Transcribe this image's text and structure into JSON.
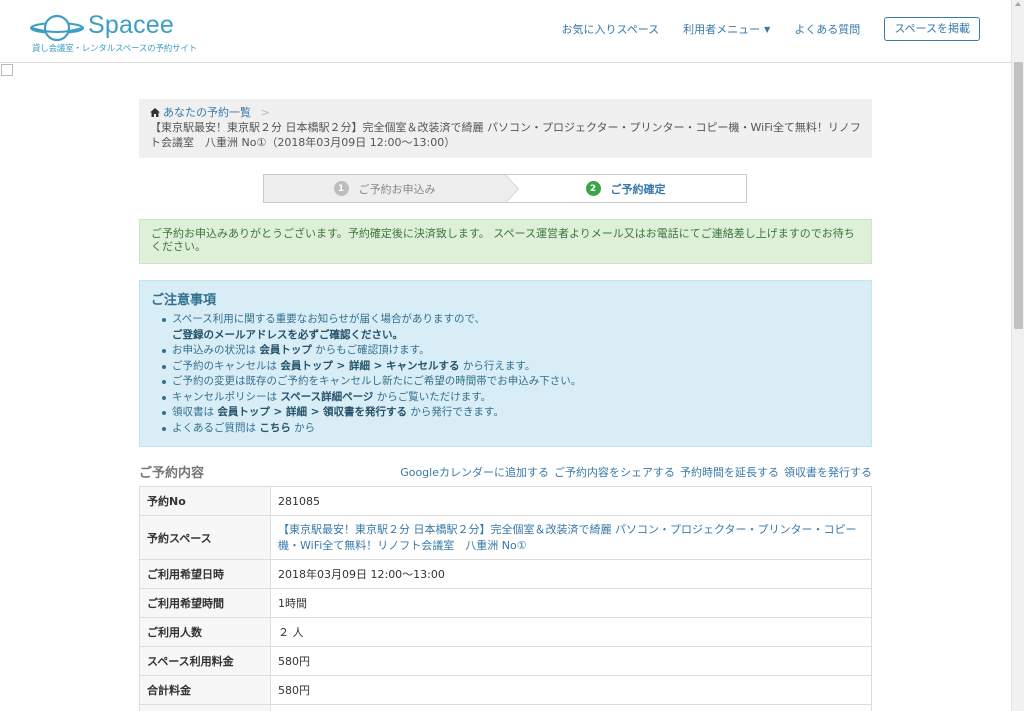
{
  "header": {
    "logo_text": "Spacee",
    "logo_sub": "貸し会議室・レンタルスペースの予約サイト",
    "nav": {
      "favorites": "お気に入りスペース",
      "user_menu": "利用者メニュー",
      "faq": "よくある質問",
      "post_space": "スペースを掲載"
    }
  },
  "breadcrumb": {
    "home": "あなたの予約一覧",
    "separator": ">",
    "current": "【東京駅最安！東京駅２分 日本橋駅２分】完全個室＆改装済で綺麗 パソコン・プロジェクター・プリンター・コピー機・WiFi全て無料！リノフト会議室　八重洲 No①（2018年03月09日 12:00〜13:00）"
  },
  "steps": [
    {
      "num": "1",
      "label": "ご予約お申込み"
    },
    {
      "num": "2",
      "label": "ご予約確定"
    }
  ],
  "alert_success": "ご予約お申込みありがとうございます。予約確定後に決済致します。 スペース運営者よりメール又はお電話にてご連絡差し上げますのでお待ちください。",
  "notice": {
    "title": "ご注意事項",
    "items": [
      {
        "pre": "スペース利用に関する重要なお知らせが届く場合がありますので、",
        "b": "",
        "post": ""
      },
      {
        "pre": "",
        "b": "ご登録のメールアドレスを必ずご確認ください。",
        "post": ""
      },
      {
        "pre": "お申込みの状況は ",
        "b": "会員トップ",
        "post": " からもご確認頂けます。"
      },
      {
        "pre": "ご予約のキャンセルは ",
        "b": "会員トップ > 詳細 > キャンセルする",
        "post": " から行えます。"
      },
      {
        "pre": "ご予約の変更は既存のご予約をキャンセルし新たにご希望の時間帯でお申込み下さい。",
        "b": "",
        "post": ""
      },
      {
        "pre": "キャンセルポリシーは ",
        "b": "スペース詳細ページ",
        "post": " からご覧いただけます。"
      },
      {
        "pre": "領収書は ",
        "b": "会員トップ > 詳細 > 領収書を発行する",
        "post": " から発行できます。"
      },
      {
        "pre": "よくあるご質問は ",
        "b": "こちら",
        "post": " から"
      }
    ]
  },
  "section": {
    "title": "ご予約内容",
    "links": [
      "Googleカレンダーに追加する",
      "ご予約内容をシェアする",
      "予約時間を延長する",
      "領収書を発行する"
    ]
  },
  "details": [
    {
      "label": "予約No",
      "value": "281085"
    },
    {
      "label": "予約スペース",
      "value": "【東京駅最安！東京駅２分 日本橋駅２分】完全個室＆改装済で綺麗 パソコン・プロジェクター・プリンター・コピー機・WiFi全て無料！リノフト会議室　八重洲 No①"
    },
    {
      "label": "ご利用希望日時",
      "value": "2018年03月09日 12:00〜13:00"
    },
    {
      "label": "ご利用希望時間",
      "value": "1時間"
    },
    {
      "label": "ご利用人数",
      "value": "２ 人"
    },
    {
      "label": "スペース利用料金",
      "value": "580円"
    },
    {
      "label": "合計料金",
      "value": "580円"
    },
    {
      "label": "",
      "value": ""
    }
  ],
  "colors": {
    "brand": "#3d9ec4",
    "link": "#3779a9",
    "success_bg": "#dff0d8",
    "info_bg": "#d9edf7",
    "step_active": "#3aa446"
  }
}
